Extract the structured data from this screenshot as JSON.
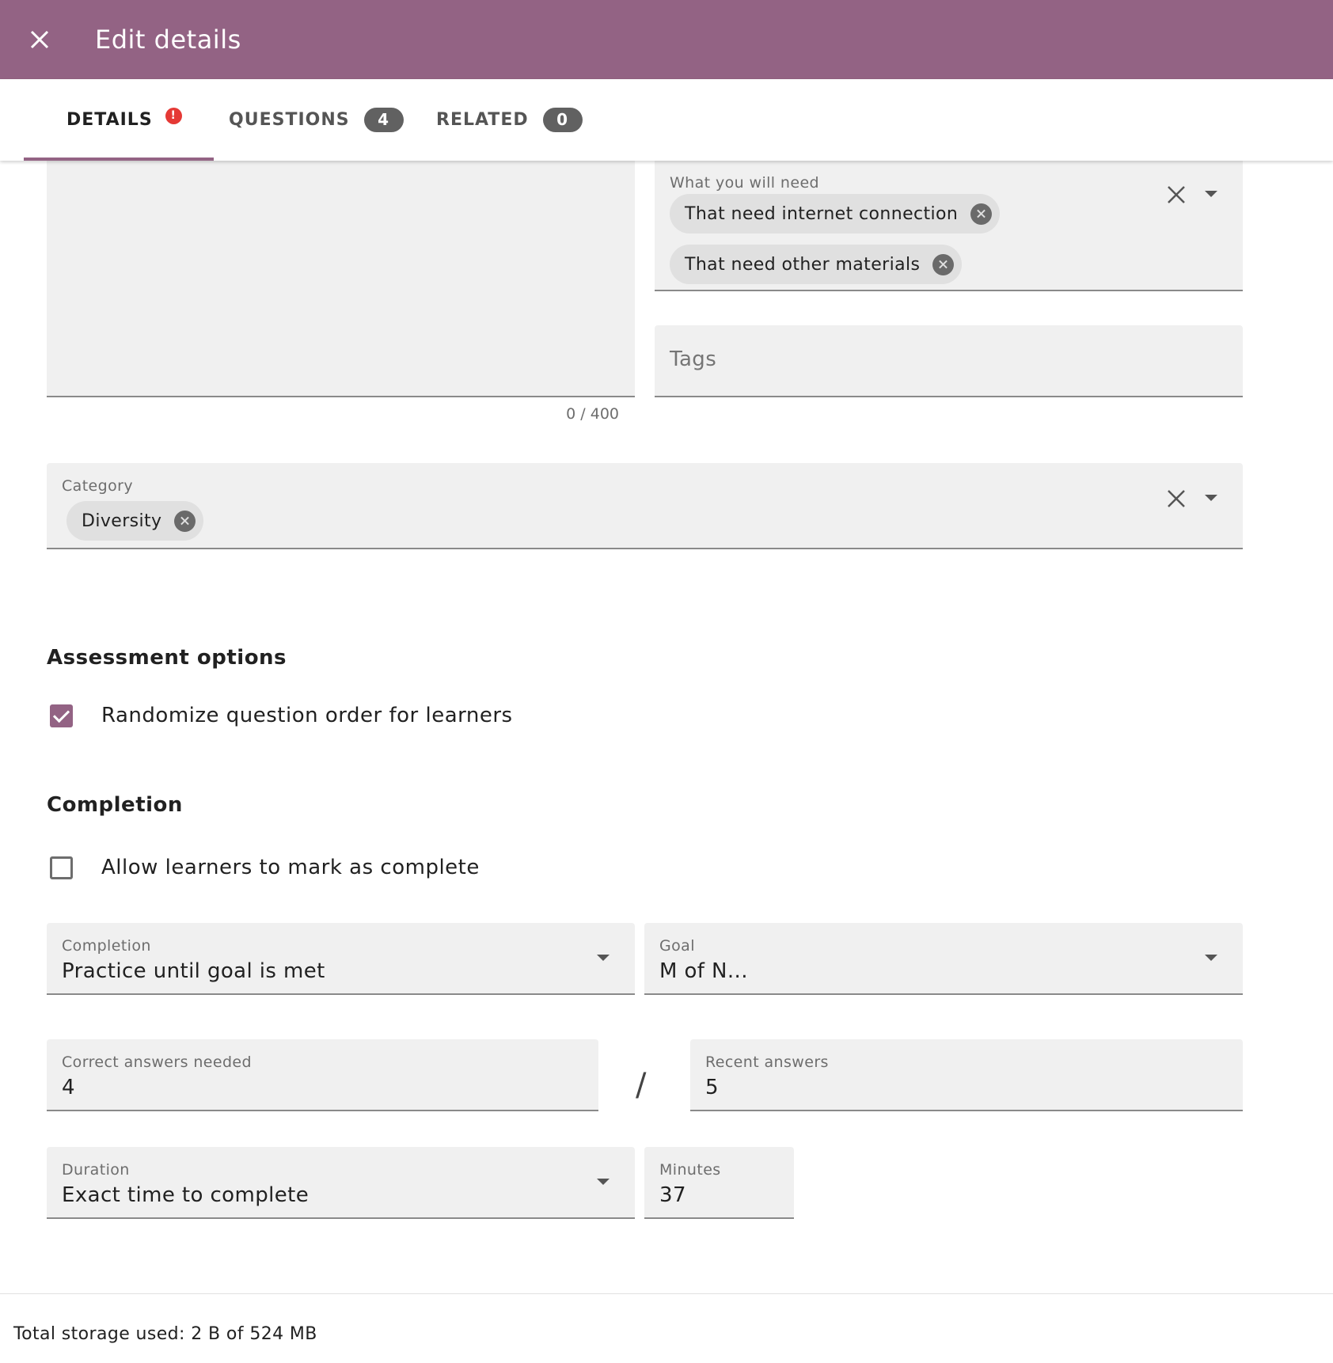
{
  "header": {
    "title": "Edit details"
  },
  "tabs": [
    {
      "label": "DETAILS",
      "error_mark": "!"
    },
    {
      "label": "QUESTIONS",
      "count": "4"
    },
    {
      "label": "RELATED",
      "count": "0"
    }
  ],
  "description": {
    "counter": "0 / 400"
  },
  "what_you_will_need": {
    "label": "What you will need",
    "chips": [
      "That need internet connection",
      "That need other materials"
    ]
  },
  "tags": {
    "placeholder": "Tags"
  },
  "category": {
    "label": "Category",
    "chips": [
      "Diversity"
    ]
  },
  "assessment_options": {
    "title": "Assessment options",
    "randomize_label": "Randomize question order for learners",
    "randomize_checked": true
  },
  "completion_section": {
    "title": "Completion",
    "allow_mark_label": "Allow learners to mark as complete",
    "allow_mark_checked": false
  },
  "completion": {
    "label": "Completion",
    "value": "Practice until goal is met"
  },
  "goal": {
    "label": "Goal",
    "value": "M of N..."
  },
  "correct_answers": {
    "label": "Correct answers needed",
    "value": "4"
  },
  "separator": "/",
  "recent_answers": {
    "label": "Recent answers",
    "value": "5"
  },
  "duration": {
    "label": "Duration",
    "value": "Exact time to complete"
  },
  "minutes": {
    "label": "Minutes",
    "value": "37"
  },
  "footer": {
    "storage_text": "Total storage used: 2 B of 524 MB"
  },
  "colors": {
    "brand": "#936384",
    "error": "#e53935",
    "badge": "#616161"
  }
}
